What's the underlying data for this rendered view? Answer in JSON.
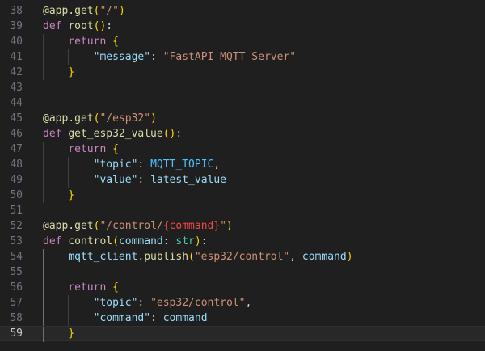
{
  "editor": {
    "active_line": 59,
    "theme_colors": {
      "background": "#1f1f1f",
      "line_number": "#6e7681",
      "active_line_number": "#cccccc",
      "current_line_highlight": "#282828"
    },
    "lines": [
      {
        "number": 38,
        "tokens": [
          {
            "t": "@app.get",
            "c": "t-dec"
          },
          {
            "t": "(",
            "c": "t-br1"
          },
          {
            "t": "\"/\"",
            "c": "t-str"
          },
          {
            "t": ")",
            "c": "t-br1"
          }
        ]
      },
      {
        "number": 39,
        "tokens": [
          {
            "t": "def ",
            "c": "t-kw"
          },
          {
            "t": "root",
            "c": "t-fn"
          },
          {
            "t": "()",
            "c": "t-br1"
          },
          {
            "t": ":",
            "c": "t-plain"
          }
        ]
      },
      {
        "number": 40,
        "tokens": [
          {
            "t": "    ",
            "c": "t-plain"
          },
          {
            "t": "return ",
            "c": "t-kw"
          },
          {
            "t": "{",
            "c": "t-br1"
          }
        ]
      },
      {
        "number": 41,
        "tokens": [
          {
            "t": "        ",
            "c": "t-plain"
          },
          {
            "t": "\"message\"",
            "c": "t-key"
          },
          {
            "t": ": ",
            "c": "t-plain"
          },
          {
            "t": "\"FastAPI MQTT Server\"",
            "c": "t-str"
          }
        ]
      },
      {
        "number": 42,
        "tokens": [
          {
            "t": "    ",
            "c": "t-plain"
          },
          {
            "t": "}",
            "c": "t-br1"
          }
        ]
      },
      {
        "number": 43,
        "tokens": []
      },
      {
        "number": 44,
        "tokens": []
      },
      {
        "number": 45,
        "tokens": [
          {
            "t": "@app.get",
            "c": "t-dec"
          },
          {
            "t": "(",
            "c": "t-br1"
          },
          {
            "t": "\"/esp32\"",
            "c": "t-str"
          },
          {
            "t": ")",
            "c": "t-br1"
          }
        ]
      },
      {
        "number": 46,
        "tokens": [
          {
            "t": "def ",
            "c": "t-kw"
          },
          {
            "t": "get_esp32_value",
            "c": "t-fn"
          },
          {
            "t": "()",
            "c": "t-br1"
          },
          {
            "t": ":",
            "c": "t-plain"
          }
        ]
      },
      {
        "number": 47,
        "tokens": [
          {
            "t": "    ",
            "c": "t-plain"
          },
          {
            "t": "return ",
            "c": "t-kw"
          },
          {
            "t": "{",
            "c": "t-br1"
          }
        ]
      },
      {
        "number": 48,
        "tokens": [
          {
            "t": "        ",
            "c": "t-plain"
          },
          {
            "t": "\"topic\"",
            "c": "t-key"
          },
          {
            "t": ": ",
            "c": "t-plain"
          },
          {
            "t": "MQTT_TOPIC",
            "c": "t-const"
          },
          {
            "t": ",",
            "c": "t-plain"
          }
        ]
      },
      {
        "number": 49,
        "tokens": [
          {
            "t": "        ",
            "c": "t-plain"
          },
          {
            "t": "\"value\"",
            "c": "t-key"
          },
          {
            "t": ": ",
            "c": "t-plain"
          },
          {
            "t": "latest_value",
            "c": "t-var"
          }
        ]
      },
      {
        "number": 50,
        "tokens": [
          {
            "t": "    ",
            "c": "t-plain"
          },
          {
            "t": "}",
            "c": "t-br1"
          }
        ]
      },
      {
        "number": 51,
        "tokens": []
      },
      {
        "number": 52,
        "tokens": [
          {
            "t": "@app.get",
            "c": "t-dec"
          },
          {
            "t": "(",
            "c": "t-br1"
          },
          {
            "t": "\"/control/",
            "c": "t-str"
          },
          {
            "t": "{command}",
            "c": "t-tmpl"
          },
          {
            "t": "\"",
            "c": "t-str"
          },
          {
            "t": ")",
            "c": "t-br1"
          }
        ]
      },
      {
        "number": 53,
        "tokens": [
          {
            "t": "def ",
            "c": "t-kw"
          },
          {
            "t": "control",
            "c": "t-fn"
          },
          {
            "t": "(",
            "c": "t-br1"
          },
          {
            "t": "command",
            "c": "t-var"
          },
          {
            "t": ": ",
            "c": "t-plain"
          },
          {
            "t": "str",
            "c": "t-type"
          },
          {
            "t": ")",
            "c": "t-br1"
          },
          {
            "t": ":",
            "c": "t-plain"
          }
        ]
      },
      {
        "number": 54,
        "tokens": [
          {
            "t": "    ",
            "c": "t-plain"
          },
          {
            "t": "mqtt_client",
            "c": "t-var"
          },
          {
            "t": ".",
            "c": "t-plain"
          },
          {
            "t": "publish",
            "c": "t-fn"
          },
          {
            "t": "(",
            "c": "t-br1"
          },
          {
            "t": "\"esp32/control\"",
            "c": "t-str"
          },
          {
            "t": ", ",
            "c": "t-plain"
          },
          {
            "t": "command",
            "c": "t-var"
          },
          {
            "t": ")",
            "c": "t-br1"
          }
        ]
      },
      {
        "number": 55,
        "tokens": []
      },
      {
        "number": 56,
        "tokens": [
          {
            "t": "    ",
            "c": "t-plain"
          },
          {
            "t": "return ",
            "c": "t-kw"
          },
          {
            "t": "{",
            "c": "t-br1"
          }
        ]
      },
      {
        "number": 57,
        "tokens": [
          {
            "t": "        ",
            "c": "t-plain"
          },
          {
            "t": "\"topic\"",
            "c": "t-key"
          },
          {
            "t": ": ",
            "c": "t-plain"
          },
          {
            "t": "\"esp32/control\"",
            "c": "t-str"
          },
          {
            "t": ",",
            "c": "t-plain"
          }
        ]
      },
      {
        "number": 58,
        "tokens": [
          {
            "t": "        ",
            "c": "t-plain"
          },
          {
            "t": "\"command\"",
            "c": "t-key"
          },
          {
            "t": ": ",
            "c": "t-plain"
          },
          {
            "t": "command",
            "c": "t-var"
          }
        ]
      },
      {
        "number": 59,
        "tokens": [
          {
            "t": "    ",
            "c": "t-plain"
          },
          {
            "t": "}",
            "c": "t-br1"
          }
        ]
      }
    ]
  }
}
